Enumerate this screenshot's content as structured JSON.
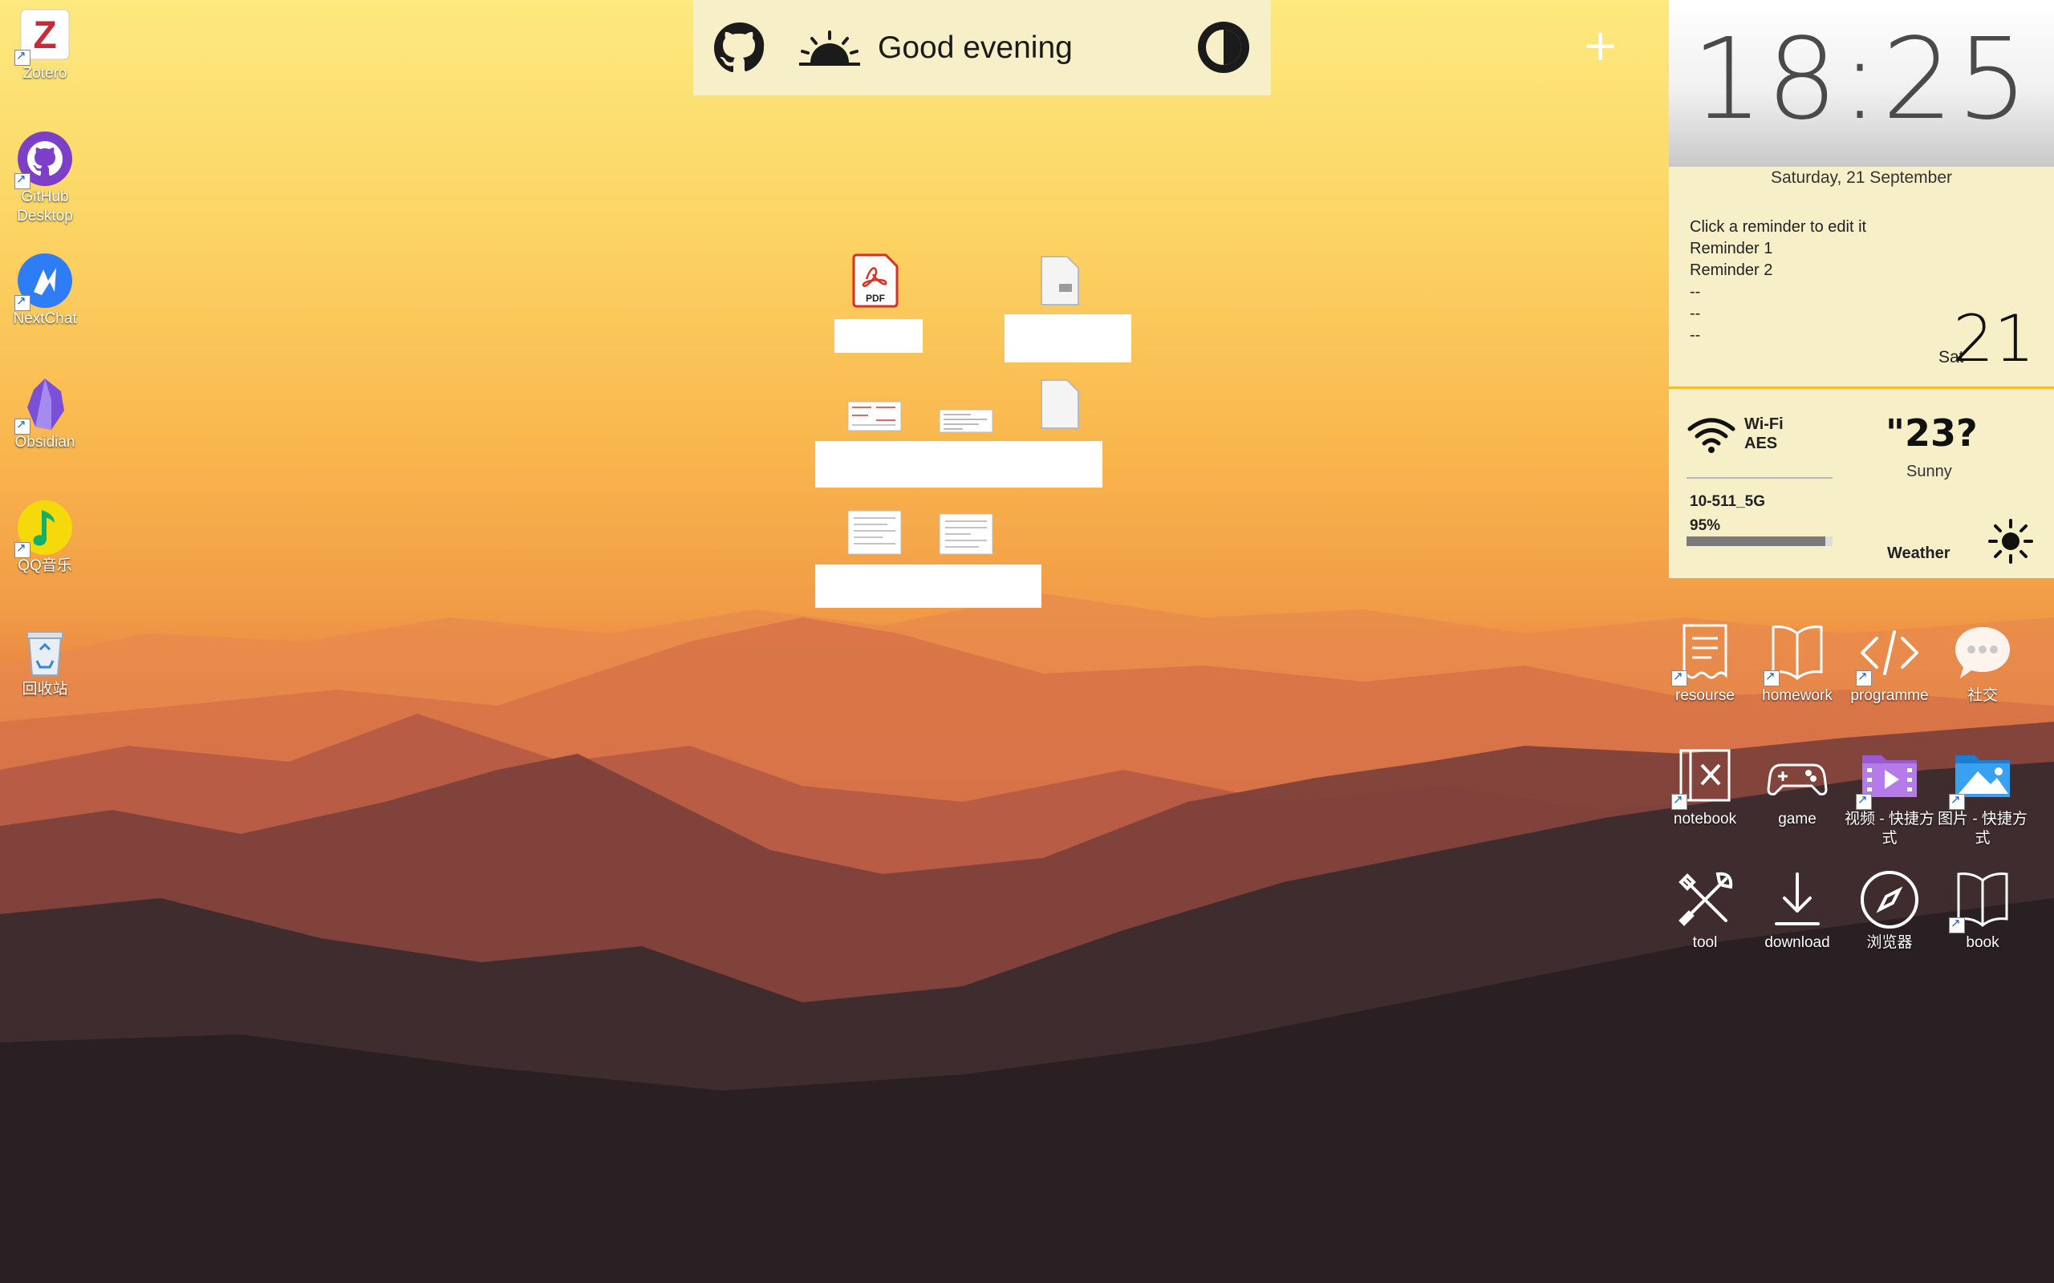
{
  "desktop_icons": [
    {
      "label": "Zotero"
    },
    {
      "label": "GitHub Desktop"
    },
    {
      "label": "NextChat"
    },
    {
      "label": "Obsidian"
    },
    {
      "label": "QQ音乐"
    },
    {
      "label": "回收站"
    }
  ],
  "topbar": {
    "greeting": "Good evening"
  },
  "clock": {
    "time": "18:25",
    "date": "Saturday, 21 September"
  },
  "reminders": {
    "lines": [
      "Click a reminder to edit it",
      "Reminder 1",
      "Reminder 2",
      "--",
      "--",
      "--"
    ],
    "weekday": "Sat",
    "day": "21"
  },
  "network": {
    "type": "Wi-Fi",
    "security": "AES",
    "ssid": "10-511_5G",
    "signal_label": "95%",
    "signal_level": 0.95
  },
  "weather": {
    "temperature": "\"23?",
    "condition": "Sunny",
    "label": "Weather"
  },
  "folders": [
    {
      "label": "resourse",
      "icon": "document-outline-icon"
    },
    {
      "label": "homework",
      "icon": "open-book-icon"
    },
    {
      "label": "programme",
      "icon": "code-icon"
    },
    {
      "label": "社交",
      "icon": "chat-bubble-icon"
    },
    {
      "label": "notebook",
      "icon": "notebook-x-icon"
    },
    {
      "label": "game",
      "icon": "gamepad-icon"
    },
    {
      "label": "视频 - 快捷方式",
      "icon": "video-folder-icon"
    },
    {
      "label": "图片 - 快捷方式",
      "icon": "picture-folder-icon"
    },
    {
      "label": "tool",
      "icon": "tools-icon"
    },
    {
      "label": "download",
      "icon": "download-icon"
    },
    {
      "label": "浏览器",
      "icon": "compass-icon"
    },
    {
      "label": "book",
      "icon": "book-icon"
    }
  ],
  "colors": {
    "widget_bg": "#f6efc8",
    "accent": "#f4bb2e"
  }
}
